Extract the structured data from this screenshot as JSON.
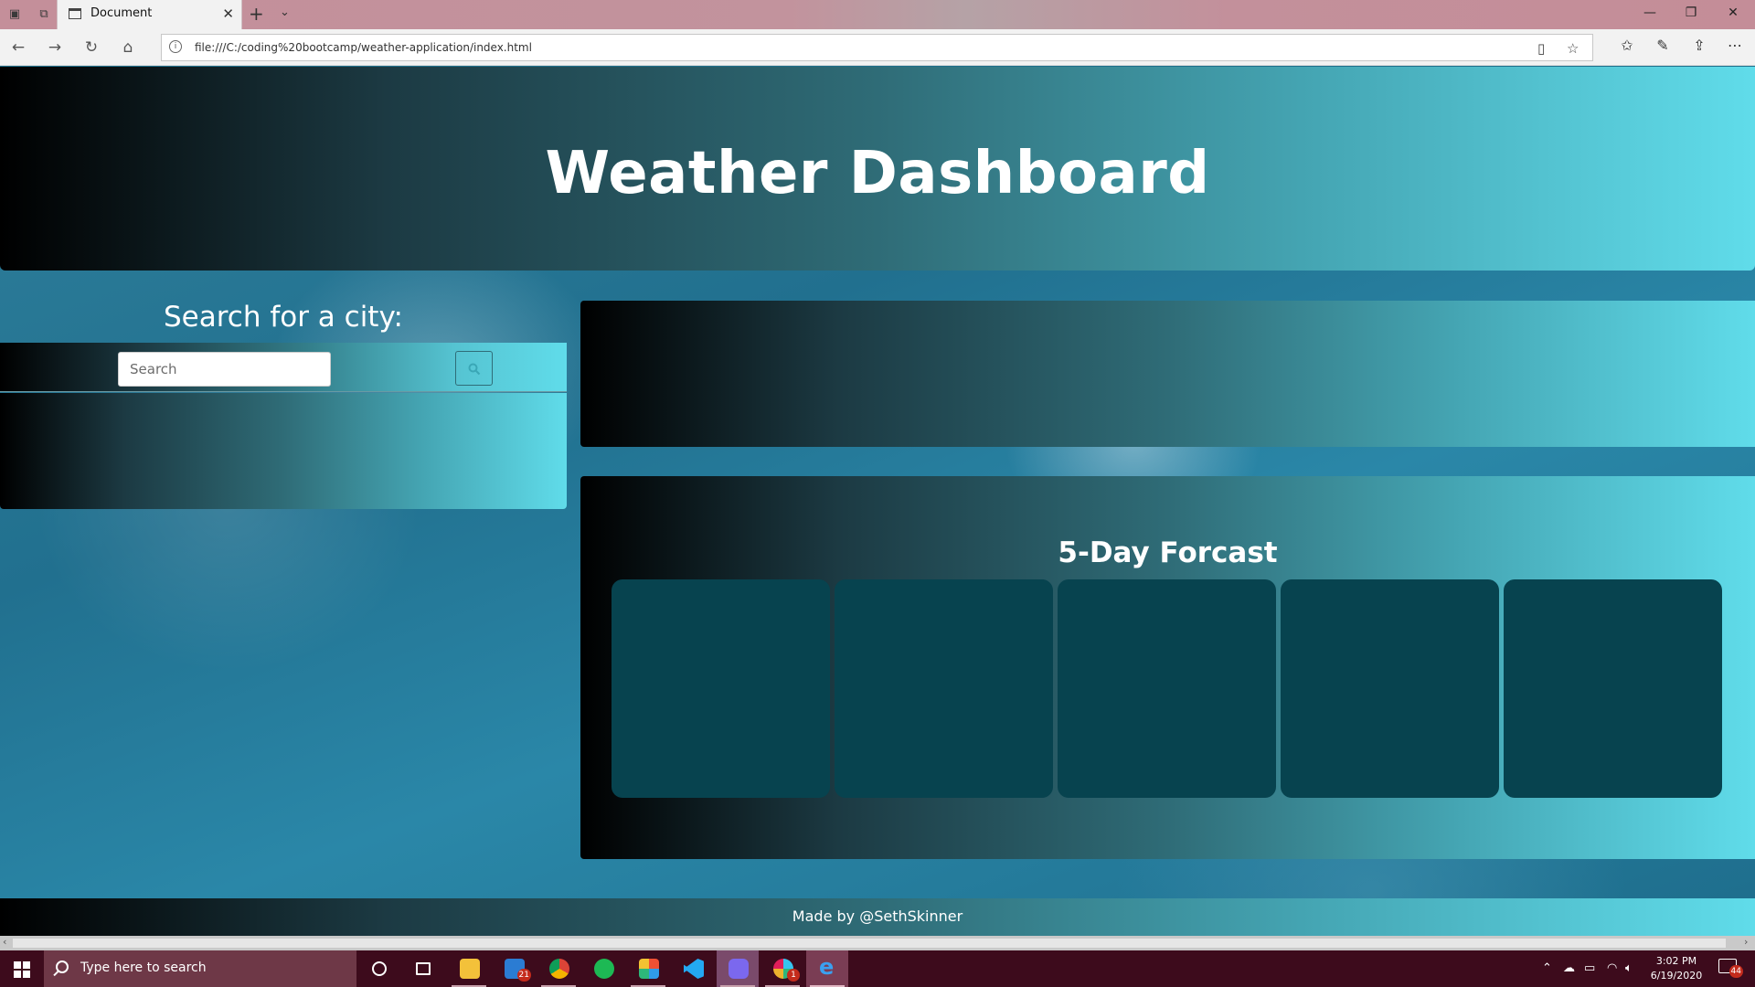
{
  "browser": {
    "tab_title": "Document",
    "url": "file:///C:/coding%20bootcamp/weather-application/index.html"
  },
  "page": {
    "title": "Weather Dashboard",
    "search_label": "Search for a city:",
    "search_placeholder": "Search",
    "forecast_title": "5-Day Forcast",
    "forecast_days": [
      "",
      "",
      "",
      "",
      ""
    ],
    "footer": "Made by @SethSkinner"
  },
  "taskbar": {
    "search_placeholder": "Type here to search",
    "mail_badge": "21",
    "slack_badge": "1",
    "notification_count": "44",
    "time": "3:02 PM",
    "date": "6/19/2020"
  },
  "colors": {
    "gradient_start": "#000000",
    "gradient_end": "#60dcea",
    "forecast_card": "#07434f",
    "taskbar": "#3d0b1c"
  }
}
